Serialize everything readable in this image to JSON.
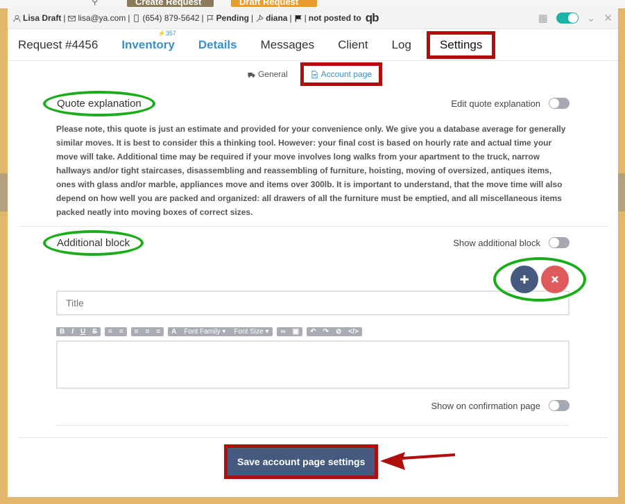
{
  "background": {
    "create_request_label": "Create Request",
    "draft_request_label": "Draft Request"
  },
  "infobar": {
    "name": "Lisa Draft",
    "email": "lisa@ya.com",
    "phone": "(654) 879-5642",
    "status": "Pending",
    "agent": "diana",
    "posting": "not posted to",
    "qb_logo": "qb"
  },
  "tabs": {
    "request": "Request #4456",
    "inventory": "Inventory",
    "inventory_count": "357",
    "details": "Details",
    "messages": "Messages",
    "client": "Client",
    "log": "Log",
    "settings": "Settings"
  },
  "subtabs": {
    "general": "General",
    "account_page": "Account page"
  },
  "quote": {
    "heading": "Quote explanation",
    "toggle_label": "Edit quote explanation",
    "text": "Please note, this quote is just an estimate and provided for your convenience only. We give you a database average for generally similar moves. It is best to consider this a thinking tool. However: your final cost is based on hourly rate and actual time your move will take. Additional time may be required if your move involves long walks from your apartment to the truck, narrow hallways and/or tight staircases, disassembling and reassembling of furniture, hoisting, moving of oversized, antiques items, ones with glass and/or marble, appliances move and items over 300lb. It is important to understand, that the move time will also depend on how well you are packed and organized: all drawers of all the furniture must be emptied, and all miscellaneous items packed neatly into moving boxes of correct sizes."
  },
  "additional": {
    "heading": "Additional block",
    "toggle_label": "Show additional block",
    "title_placeholder": "Title",
    "font_family_label": "Font Family",
    "font_size_label": "Font Size",
    "confirm_label": "Show on confirmation page"
  },
  "footer": {
    "save_label": "Save account page settings"
  },
  "colors": {
    "highlight_red": "#b00d0d",
    "highlight_green": "#19ad1a",
    "accent_blue": "#3a8fcb",
    "button_navy": "#465a80",
    "toggle_teal": "#1eb2a6"
  }
}
